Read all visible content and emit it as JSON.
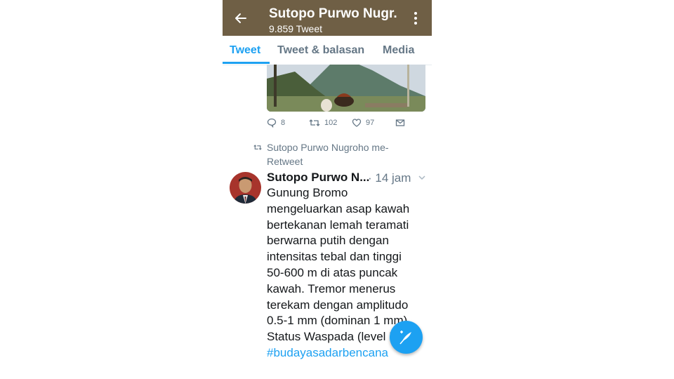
{
  "header": {
    "name": "Sutopo Purwo Nugr.",
    "tweet_count": "9.859 Tweet",
    "colors": {
      "bar": "#6f5f45",
      "accent": "#1da1f2"
    }
  },
  "tabs": [
    {
      "label": "Tweet",
      "active": true
    },
    {
      "label": "Tweet & balasan",
      "active": false
    },
    {
      "label": "Media",
      "active": false
    }
  ],
  "previous_tweet": {
    "actions": {
      "replies": "8",
      "retweets": "102",
      "likes": "97"
    }
  },
  "tweet": {
    "retweet_label": "Sutopo Purwo Nugroho me-Retweet",
    "author": "Sutopo Purwo N...",
    "time": "· 14 jam",
    "lines": [
      "Gunung Bromo",
      "mengeluarkan asap kawah",
      "bertekanan lemah teramati",
      "berwarna putih dengan",
      "intensitas tebal dan tinggi",
      "50-600 m di atas puncak",
      "kawah. Tremor menerus",
      "terekam dengan amplitudo",
      "0.5-1 mm (dominan 1 mm)",
      "Status Waspada (level II)."
    ],
    "hashtag": "#budayasadarbencana"
  },
  "icons": {
    "back": "arrow-left-icon",
    "more": "more-vertical-icon",
    "reply": "reply-icon",
    "retweet": "retweet-icon",
    "like": "heart-icon",
    "message": "envelope-icon",
    "compose": "compose-feather-icon"
  }
}
